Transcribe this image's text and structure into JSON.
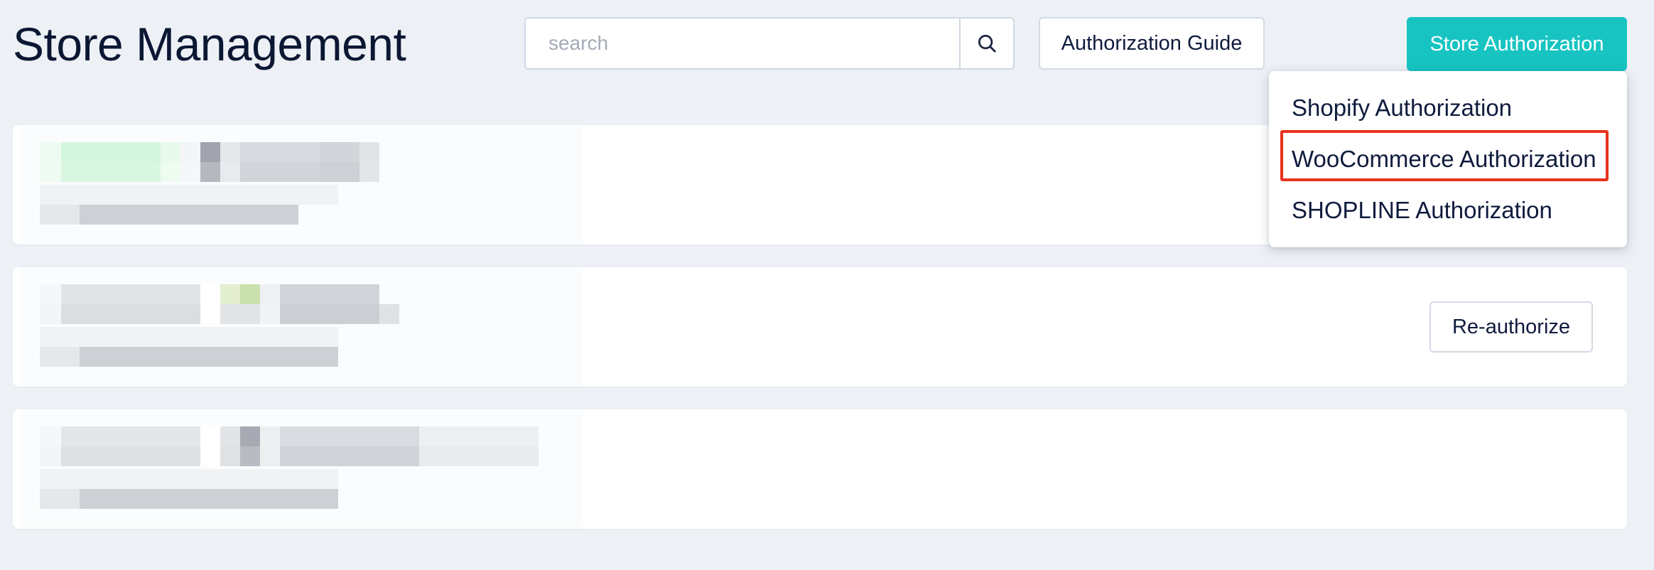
{
  "header": {
    "title": "Store Management",
    "search_placeholder": "search",
    "search_value": "",
    "guide_label": "Authorization Guide",
    "store_auth_label": "Store Authorization"
  },
  "dropdown": {
    "items": [
      {
        "label": "Shopify Authorization"
      },
      {
        "label": "WooCommerce Authorization"
      },
      {
        "label": "SHOPLINE Authorization"
      }
    ],
    "highlighted_index": 1
  },
  "stores": [
    {
      "action_label": ""
    },
    {
      "action_label": "Re-authorize"
    },
    {
      "action_label": ""
    }
  ],
  "colors": {
    "accent": "#17c4c2",
    "highlight": "#e8331d",
    "background": "#edf0f5"
  },
  "icons": {
    "search": "search-icon"
  }
}
